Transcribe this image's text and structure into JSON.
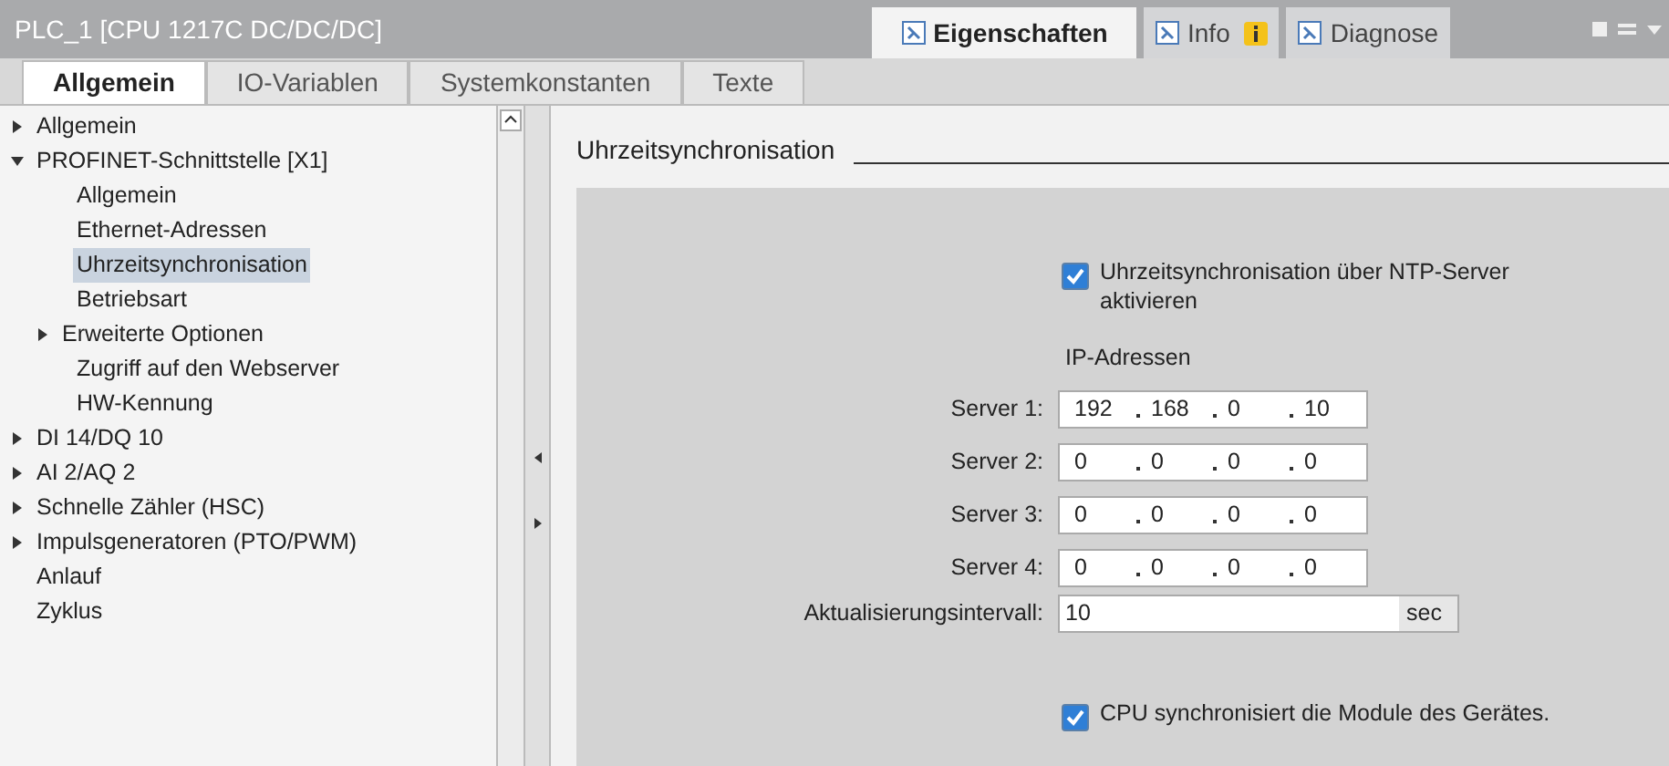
{
  "window": {
    "title": "PLC_1 [CPU 1217C DC/DC/DC]"
  },
  "inspector_tabs": [
    {
      "label": "Eigenschaften",
      "selected": true,
      "badge": false
    },
    {
      "label": "Info",
      "selected": false,
      "badge": true
    },
    {
      "label": "Diagnose",
      "selected": false,
      "badge": false
    }
  ],
  "tabs": [
    {
      "label": "Allgemein",
      "selected": true
    },
    {
      "label": "IO-Variablen",
      "selected": false
    },
    {
      "label": "Systemkonstanten",
      "selected": false
    },
    {
      "label": "Texte",
      "selected": false
    }
  ],
  "tree": [
    {
      "label": "Allgemein",
      "expanded": false,
      "selected": false
    },
    {
      "label": "PROFINET-Schnittstelle [X1]",
      "expanded": true,
      "selected": false,
      "children": [
        {
          "label": "Allgemein",
          "selected": false
        },
        {
          "label": "Ethernet-Adressen",
          "selected": false
        },
        {
          "label": "Uhrzeitsynchronisation",
          "selected": true
        },
        {
          "label": "Betriebsart",
          "selected": false
        },
        {
          "label": "Erweiterte Optionen",
          "expanded": false,
          "selected": false
        },
        {
          "label": "Zugriff auf den Webserver",
          "selected": false
        },
        {
          "label": "HW-Kennung",
          "selected": false
        }
      ]
    },
    {
      "label": "DI 14/DQ 10",
      "expanded": false,
      "selected": false
    },
    {
      "label": "AI 2/AQ 2",
      "expanded": false,
      "selected": false
    },
    {
      "label": "Schnelle Zähler (HSC)",
      "expanded": false,
      "selected": false
    },
    {
      "label": "Impulsgeneratoren (PTO/PWM)",
      "expanded": false,
      "selected": false
    },
    {
      "label": "Anlauf",
      "selected": false
    },
    {
      "label": "Zyklus",
      "selected": false
    }
  ],
  "section": {
    "title": "Uhrzeitsynchronisation",
    "ntp_checkbox": {
      "label": "Uhrzeitsynchronisation über NTP-Server aktivieren",
      "checked": true
    },
    "ip_heading": "IP-Adressen",
    "servers": [
      {
        "label": "Server 1:",
        "octets": [
          "192",
          "168",
          "0",
          "10"
        ]
      },
      {
        "label": "Server 2:",
        "octets": [
          "0",
          "0",
          "0",
          "0"
        ]
      },
      {
        "label": "Server 3:",
        "octets": [
          "0",
          "0",
          "0",
          "0"
        ]
      },
      {
        "label": "Server 4:",
        "octets": [
          "0",
          "0",
          "0",
          "0"
        ]
      }
    ],
    "interval": {
      "label": "Aktualisierungsintervall:",
      "value": "10",
      "unit": "sec"
    },
    "module_checkbox": {
      "label": "CPU synchronisiert die Module des Gerätes.",
      "checked": true
    }
  }
}
